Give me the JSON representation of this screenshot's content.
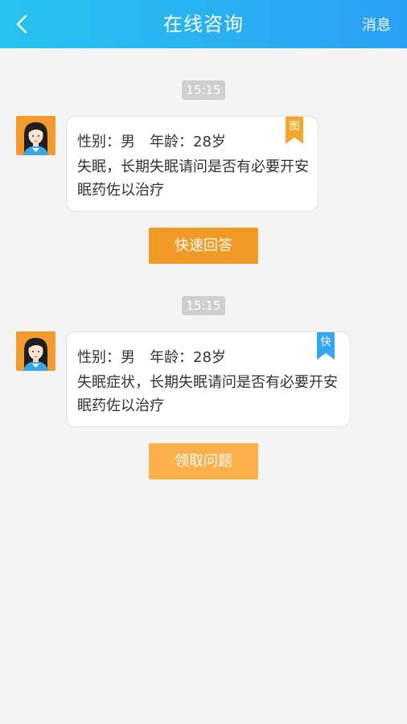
{
  "header": {
    "title": "在线咨询",
    "right_label": "消息",
    "background_start": "#27c3f0",
    "background_end": "#2aa0f5"
  },
  "consultations": [
    {
      "time": "15:15",
      "gender_label": "性别：男",
      "age_label": "年龄：28岁",
      "content": "失眠，长期失眠请问是否有必要开安眠药佐以治疗",
      "tag": "图",
      "tag_color": "#f4a72a",
      "button_label": "快速回答",
      "button_color": "#f29a26"
    },
    {
      "time": "15:15",
      "gender_label": "性别：男",
      "age_label": "年龄：28岁",
      "content": "失眠症状，长期失眠请问是否有必要开安眠药佐以治疗",
      "tag": "快",
      "tag_color": "#34a6f2",
      "button_label": "领取问题",
      "button_color": "#fbb04a"
    }
  ]
}
